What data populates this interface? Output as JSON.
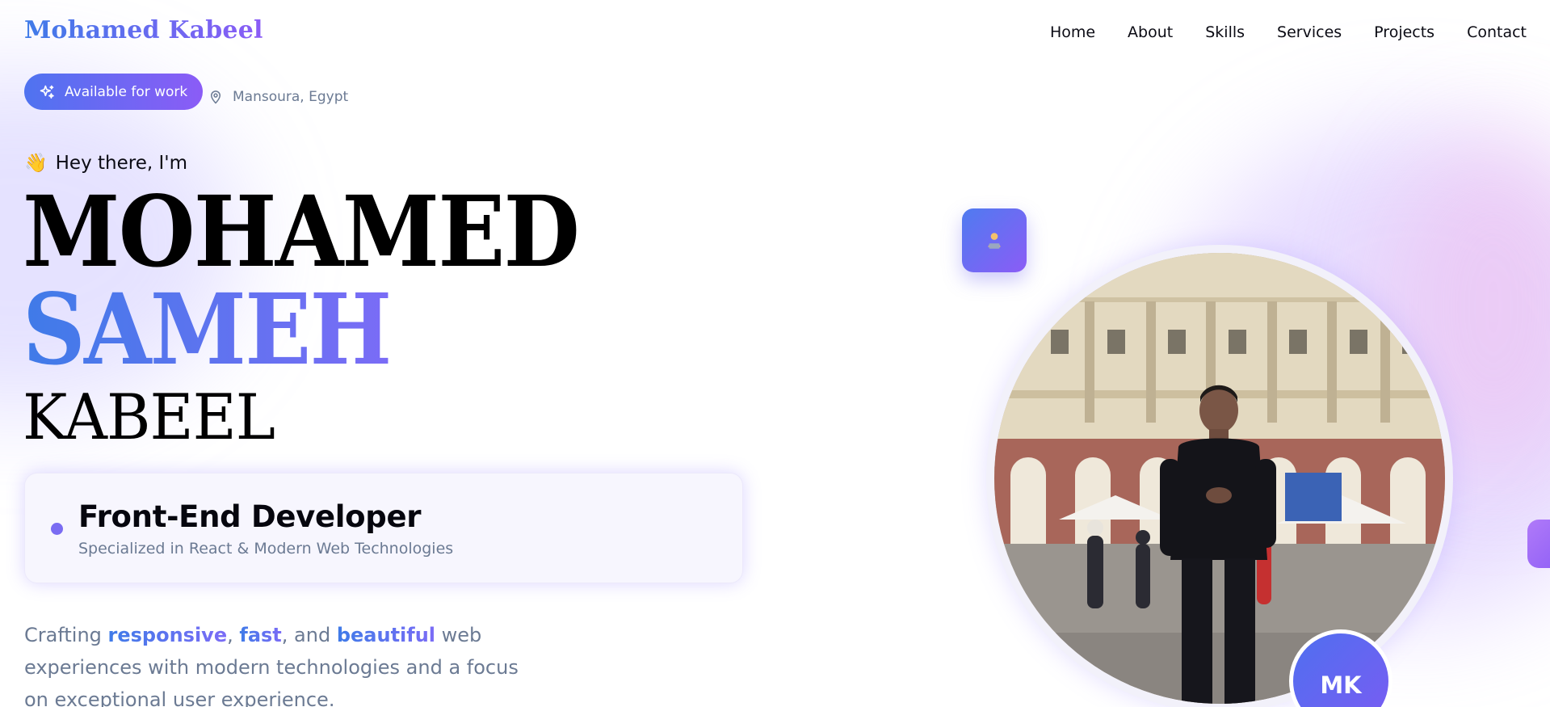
{
  "header": {
    "logo": "Mohamed Kabeel",
    "nav": [
      "Home",
      "About",
      "Skills",
      "Services",
      "Projects",
      "Contact"
    ]
  },
  "status": {
    "available_label": "Available for work",
    "location": "Mansoura, Egypt"
  },
  "hero": {
    "greeting_emoji": "👋",
    "greeting": "Hey there, I'm",
    "name_first": "MOHAMED",
    "name_middle": "SAMEH",
    "name_last": "KABEEL"
  },
  "role": {
    "title": "Front-End Developer",
    "subtitle": "Specialized in React & Modern Web Technologies"
  },
  "description": {
    "p1": "Crafting ",
    "h1": "responsive",
    "p2": ", ",
    "h2": "fast",
    "p3": ", and ",
    "h3": "beautiful",
    "p4": " web experiences with modern technologies and a focus on exceptional user experience."
  },
  "portrait": {
    "initials": "MK"
  },
  "colors": {
    "accent_blue": "#3f7be8",
    "accent_purple": "#8b5cf6",
    "muted_text": "#6b7a93"
  },
  "icons": {
    "available": "sparkle-icon",
    "location": "map-pin-icon",
    "floating_badge": "developer-at-laptop-icon"
  }
}
